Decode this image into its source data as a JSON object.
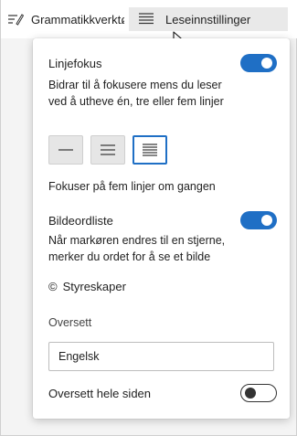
{
  "toolbar": {
    "grammar_label": "Grammatikkverktøy",
    "reading_prefs_label": "Leseinnstillinger",
    "grammar_icon": "grammar-tools-icon",
    "reading_icon": "reading-preferences-icon"
  },
  "line_focus": {
    "title": "Linjefokus",
    "enabled": true,
    "description": "Bidrar til å fokusere mens du leser ved å utheve én, tre eller fem linjer",
    "options": [
      "one-line-icon",
      "three-lines-icon",
      "five-lines-icon"
    ],
    "selected_option": 2,
    "status": "Fokuser på fem linjer om gangen"
  },
  "picture_dictionary": {
    "title": "Bildeordliste",
    "enabled": true,
    "description": "Når markøren endres til en stjerne, merker du ordet for å se et bilde",
    "powered_by": "Styreskaper",
    "powered_symbol": "©"
  },
  "translate": {
    "label": "Oversett",
    "language": "Engelsk",
    "whole_page_label": "Oversett hele siden",
    "whole_page_enabled": false
  },
  "colors": {
    "accent": "#1f6fc5"
  }
}
